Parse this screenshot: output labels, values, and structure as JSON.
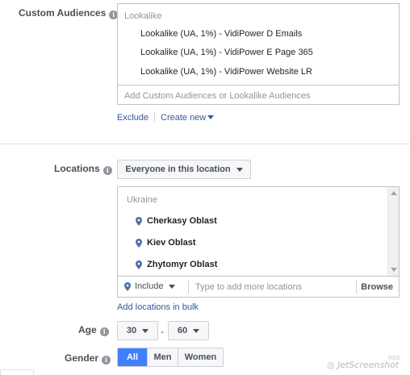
{
  "custom_audiences": {
    "label": "Custom Audiences",
    "group_label": "Lookalike",
    "items": [
      "Lookalike (UA, 1%) - VidiPower D Emails",
      "Lookalike (UA, 1%) - VidiPower E Page 365",
      "Lookalike (UA, 1%) - VidiPower Website LR"
    ],
    "input_placeholder": "Add Custom Audiences or Lookalike Audiences",
    "exclude_link": "Exclude",
    "create_new_link": "Create new"
  },
  "locations": {
    "label": "Locations",
    "dropdown_value": "Everyone in this location",
    "group_label": "Ukraine",
    "items": [
      "Cherkasy Oblast",
      "Kiev Oblast",
      "Zhytomyr Oblast"
    ],
    "include_label": "Include",
    "input_placeholder": "Type to add more locations",
    "browse_label": "Browse",
    "bulk_link": "Add locations in bulk"
  },
  "age": {
    "label": "Age",
    "min": "30",
    "separator": "-",
    "max": "60"
  },
  "gender": {
    "label": "Gender",
    "options": [
      "All",
      "Men",
      "Women"
    ],
    "selected": "All"
  },
  "watermark": {
    "text": "JetScreenshot",
    "small": "RSS"
  },
  "colors": {
    "accent": "#4080ff",
    "link": "#365899",
    "pin": "#4b6ea9"
  }
}
